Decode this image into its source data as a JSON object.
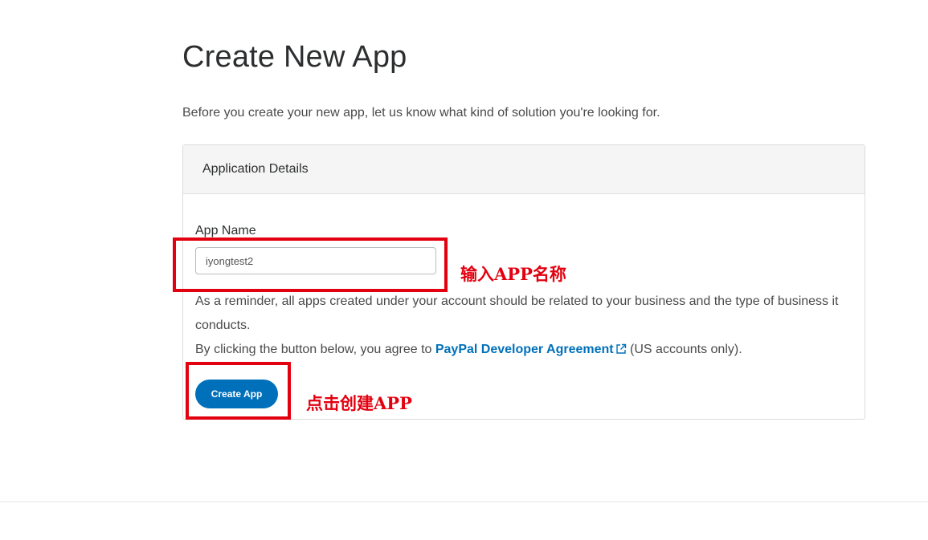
{
  "page": {
    "title": "Create New App",
    "intro": "Before you create your new app, let us know what kind of solution you're looking for."
  },
  "card": {
    "header": "Application Details",
    "app_name_label": "App Name",
    "app_name_value": "iyongtest2",
    "reminder": "As a reminder, all apps created under your account should be related to your business and the type of business it conducts.",
    "agreement_prefix": "By clicking the button below, you agree to ",
    "agreement_link": "PayPal Developer Agreement",
    "agreement_suffix": " (US accounts only).",
    "create_button": "Create App"
  },
  "annotations": {
    "input_hint": "输入APP名称",
    "button_hint": "点击创建APP",
    "color": "#e3000f"
  },
  "colors": {
    "accent": "#0070ba",
    "header_bg": "#f5f5f5"
  },
  "icons": {
    "agreement_link_icon": "external-link-icon"
  }
}
